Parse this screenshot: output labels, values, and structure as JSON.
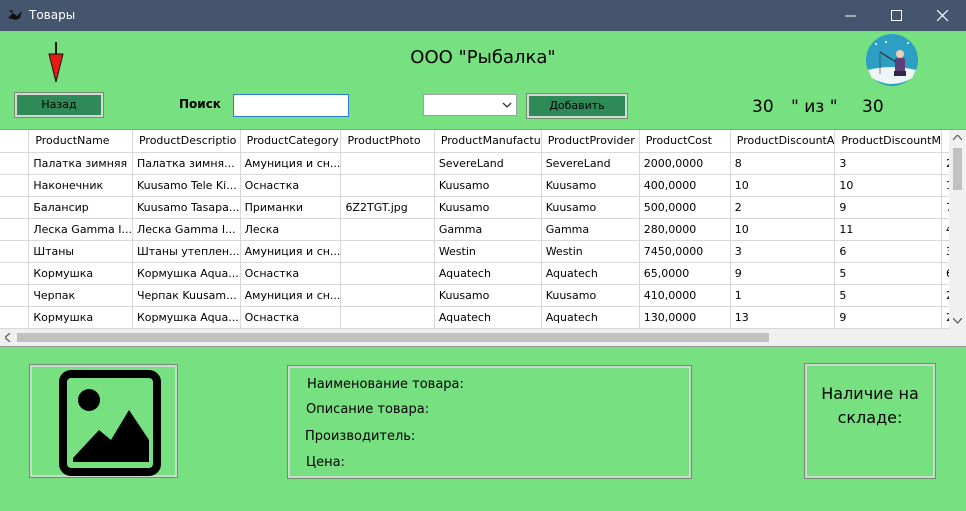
{
  "window": {
    "title": "Товары"
  },
  "header": {
    "company": "ООО \"Рыбалка\""
  },
  "toolbar": {
    "back_label": "Назад",
    "search_label": "Поиск",
    "search_value": "",
    "filter_value": "",
    "add_label": "Добавить"
  },
  "counter": {
    "shown": "30",
    "separator": "\" из \"",
    "total": "30"
  },
  "table": {
    "columns": [
      "ProductName",
      "ProductDescriptio",
      "ProductCategory",
      "ProductPhoto",
      "ProductManufactu",
      "ProductProvider",
      "ProductCost",
      "ProductDiscountA",
      "ProductDiscountM",
      ""
    ],
    "rows": [
      [
        "Палатка зимняя",
        "Палатка зимня...",
        "Амуниция и сн...",
        "",
        "SevereLand",
        "SevereLand",
        "2000,0000",
        "8",
        "3",
        "2"
      ],
      [
        "Наконечник",
        "Kuusamo Tele Ki...",
        "Оснастка",
        "",
        "Kuusamo",
        "Kuusamo",
        "400,0000",
        "10",
        "10",
        "1"
      ],
      [
        "Балансир",
        "Kuusamo Tasapa...",
        "Приманки",
        "6Z2TGT.jpg",
        "Kuusamo",
        "Kuusamo",
        "500,0000",
        "2",
        "9",
        "7"
      ],
      [
        "Леска Gamma I...",
        "Леска Gamma I...",
        "Леска",
        "",
        "Gamma",
        "Gamma",
        "280,0000",
        "10",
        "11",
        "4"
      ],
      [
        "Штаны",
        "Штаны утеплен...",
        "Амуниция и сн...",
        "",
        "Westin",
        "Westin",
        "7450,0000",
        "3",
        "6",
        "3"
      ],
      [
        "Кормушка",
        "Кормушка Aqua...",
        "Оснастка",
        "",
        "Aquatech",
        "Aquatech",
        "65,0000",
        "9",
        "5",
        "6"
      ],
      [
        "Черпак",
        "Черпак Kuusam...",
        "Амуниция и сн...",
        "",
        "Kuusamo",
        "Kuusamo",
        "410,0000",
        "1",
        "5",
        "2"
      ],
      [
        "Кормушка",
        "Кормушка Aqua...",
        "Оснастка",
        "",
        "Aquatech",
        "Aquatech",
        "130,0000",
        "13",
        "9",
        "2"
      ]
    ]
  },
  "details": {
    "name_label": "Наименование товара:",
    "description_label": "Описание товара:",
    "manufacturer_label": "Производитель:",
    "price_label": "Цена:",
    "stock_line1": "Наличие на",
    "stock_line2": "складе:"
  },
  "icons": {
    "app": "fish-icon",
    "logo": "ice-fishing-logo",
    "arrow": "red-down-arrow-icon",
    "placeholder": "image-placeholder-icon"
  },
  "colors": {
    "background": "#77e080",
    "titlebar": "#46556e",
    "button": "#2e8b57",
    "arrow": "#e8190f"
  }
}
